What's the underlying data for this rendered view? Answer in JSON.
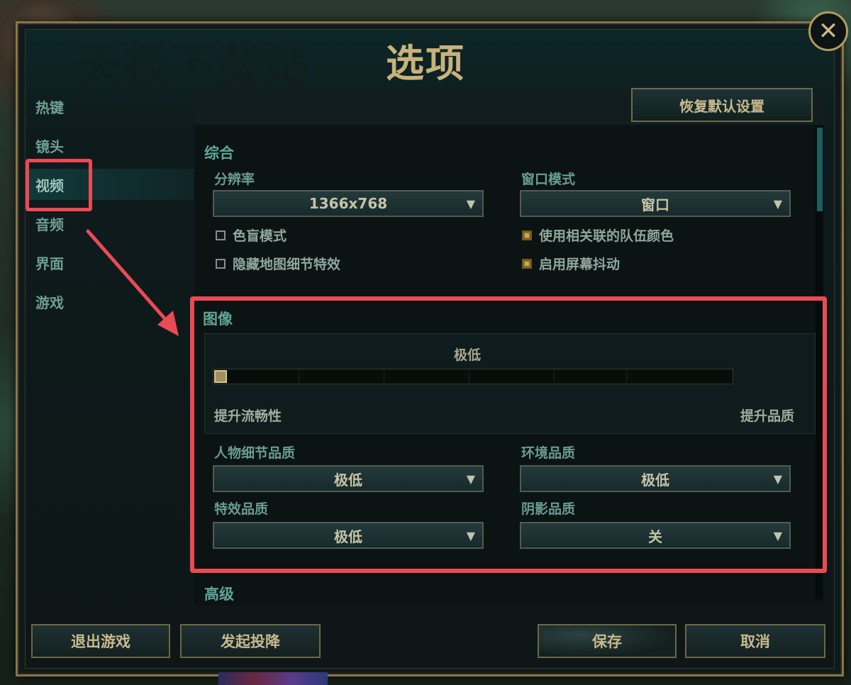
{
  "watermark": {
    "main": "天极下载站",
    "sub": "mydown"
  },
  "dialog": {
    "title": "选项",
    "close_icon": "close-icon"
  },
  "sidebar": {
    "items": [
      {
        "label": "热键"
      },
      {
        "label": "镜头"
      },
      {
        "label": "视频",
        "active": true
      },
      {
        "label": "音频"
      },
      {
        "label": "界面"
      },
      {
        "label": "游戏"
      }
    ]
  },
  "toolbar": {
    "reset_label": "恢复默认设置"
  },
  "general": {
    "title": "综合",
    "resolution": {
      "label": "分辨率",
      "value": "1366x768"
    },
    "window_mode": {
      "label": "窗口模式",
      "value": "窗口"
    },
    "checks": [
      {
        "label": "色盲模式",
        "checked": false
      },
      {
        "label": "隐藏地图细节特效",
        "checked": false
      },
      {
        "label": "使用相关联的队伍颜色",
        "checked": true
      },
      {
        "label": "启用屏幕抖动",
        "checked": true
      }
    ]
  },
  "graphics": {
    "title": "图像",
    "quality_level": "极低",
    "slider_fraction": 0.0,
    "left_hint": "提升流畅性",
    "right_hint": "提升品质",
    "character_quality": {
      "label": "人物细节品质",
      "value": "极低"
    },
    "environment_quality": {
      "label": "环境品质",
      "value": "极低"
    },
    "effects_quality": {
      "label": "特效品质",
      "value": "极低"
    },
    "shadow_quality": {
      "label": "阴影品质",
      "value": "关"
    }
  },
  "advanced": {
    "title": "高级"
  },
  "footer": {
    "quit_label": "退出游戏",
    "surrender_label": "发起投降",
    "save_label": "保存",
    "cancel_label": "取消"
  },
  "colors": {
    "accent_gold": "#c8b27a",
    "annotation_red": "#ea4a55",
    "label_teal": "#6a9c8f"
  }
}
